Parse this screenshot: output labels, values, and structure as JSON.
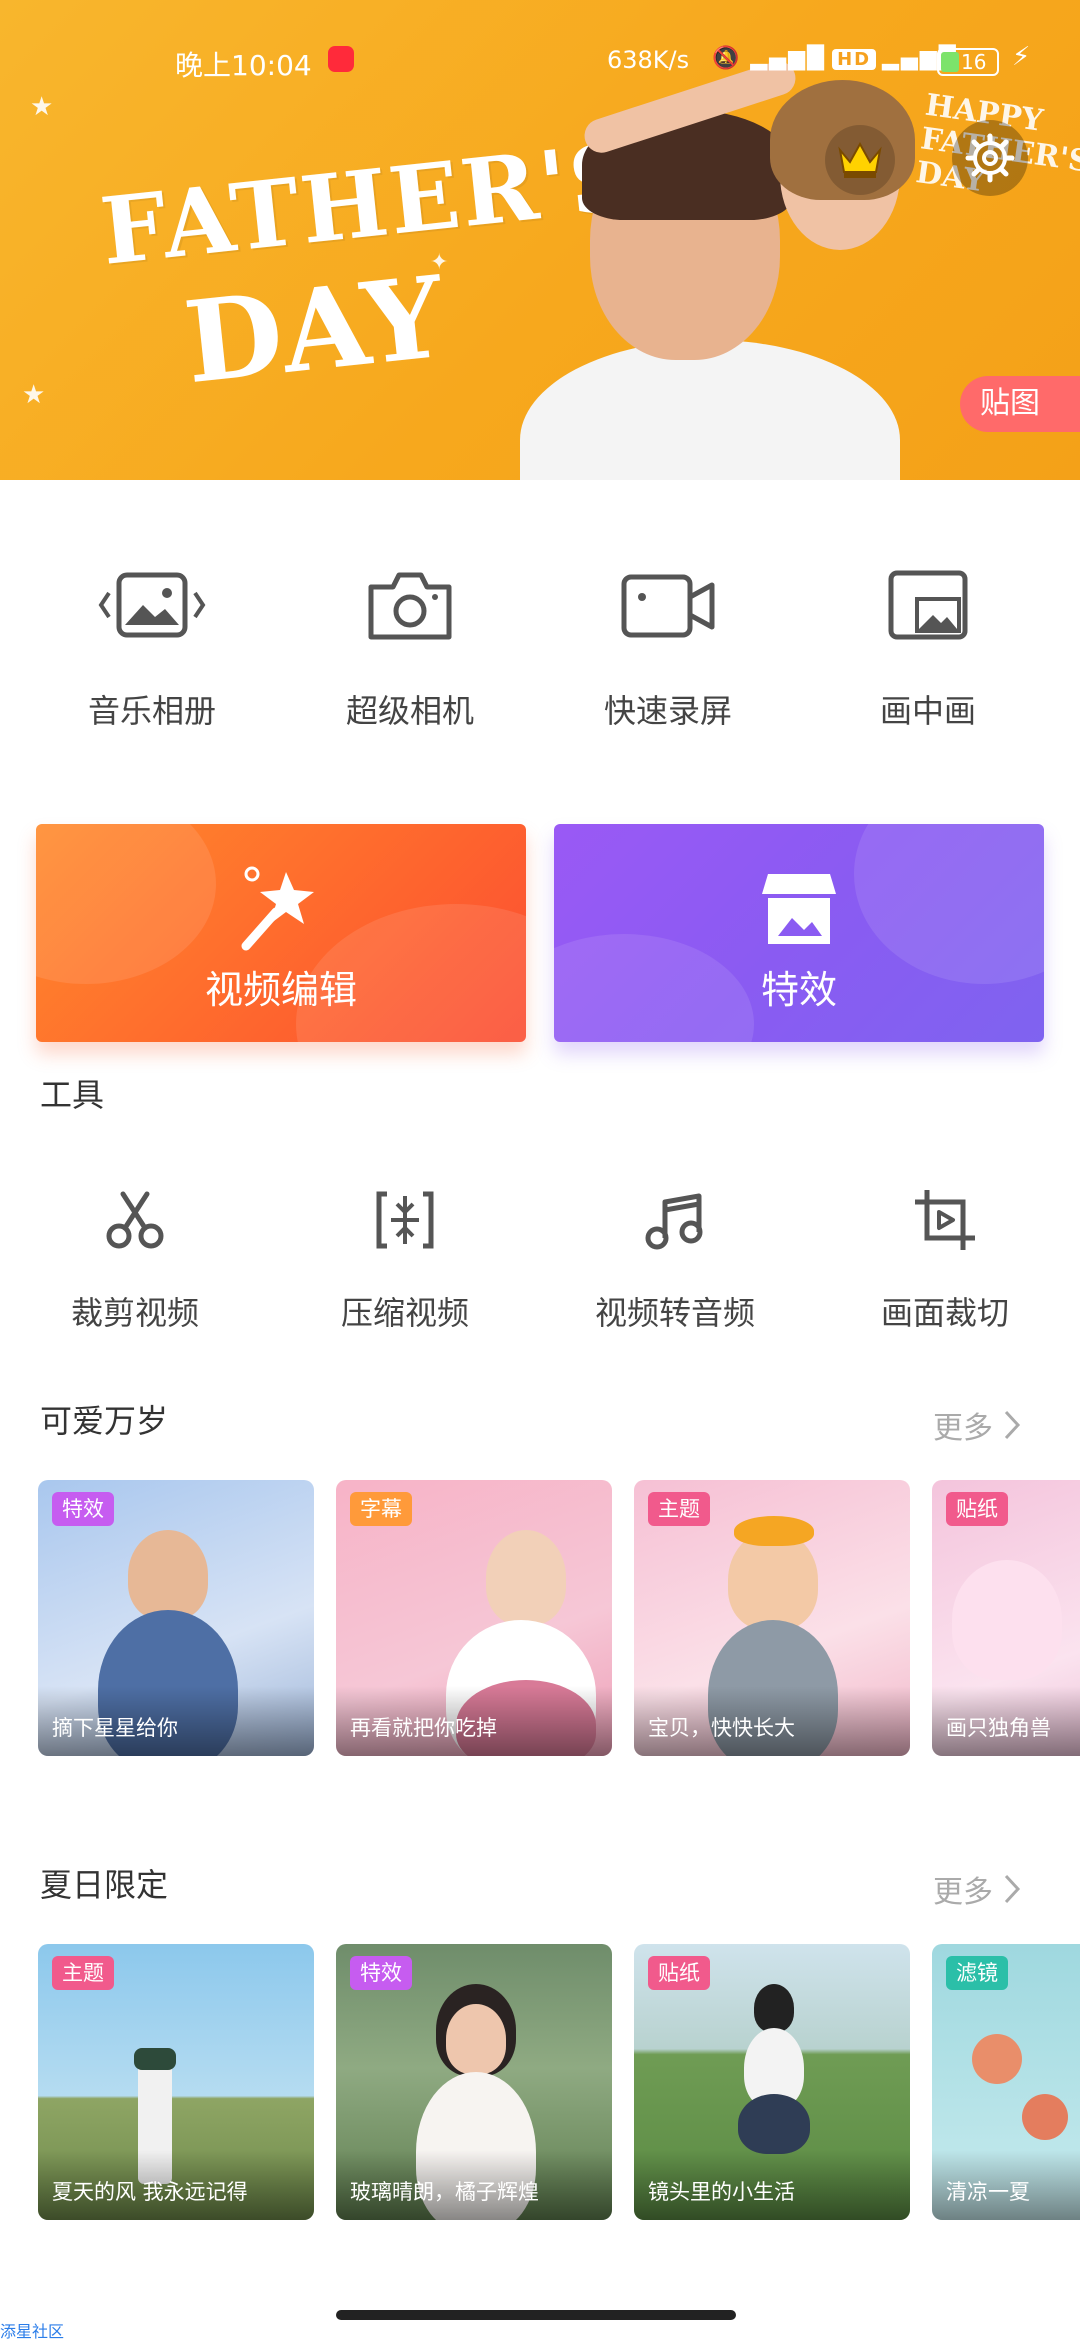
{
  "status_bar": {
    "time": "晚上10:04",
    "net_speed": "638K/s",
    "hd": "HD",
    "battery": "16"
  },
  "banner": {
    "title_line1": "FATHER'S",
    "title_line2": "DAY",
    "side_text": "HAPPY FATHER'S DAY",
    "sticker_label": "贴图"
  },
  "quick_actions": [
    {
      "label": "音乐相册",
      "icon": "photo-album-icon"
    },
    {
      "label": "超级相机",
      "icon": "camera-icon"
    },
    {
      "label": "快速录屏",
      "icon": "screen-record-icon"
    },
    {
      "label": "画中画",
      "icon": "picture-in-picture-icon"
    }
  ],
  "feature_cards": {
    "edit": {
      "label": "视频编辑",
      "icon": "magic-wand-icon"
    },
    "fx": {
      "label": "特效",
      "icon": "store-icon"
    }
  },
  "tools": {
    "title": "工具",
    "items": [
      {
        "label": "裁剪视频",
        "icon": "scissors-icon"
      },
      {
        "label": "压缩视频",
        "icon": "compress-icon"
      },
      {
        "label": "视频转音频",
        "icon": "music-note-icon"
      },
      {
        "label": "画面裁切",
        "icon": "crop-icon"
      }
    ]
  },
  "sections": [
    {
      "title": "可爱万岁",
      "more": "更多",
      "items": [
        {
          "tag": "特效",
          "caption": "摘下星星给你"
        },
        {
          "tag": "字幕",
          "caption": "再看就把你吃掉"
        },
        {
          "tag": "主题",
          "caption": "宝贝，快快长大"
        },
        {
          "tag": "贴纸",
          "caption": "画只独角兽"
        }
      ]
    },
    {
      "title": "夏日限定",
      "more": "更多",
      "items": [
        {
          "tag": "主题",
          "caption": "夏天的风 我永远记得"
        },
        {
          "tag": "特效",
          "caption": "玻璃晴朗，橘子辉煌"
        },
        {
          "tag": "贴纸",
          "caption": "镜头里的小生活"
        },
        {
          "tag": "滤镜",
          "caption": "清凉一夏"
        }
      ]
    }
  ],
  "footer": {
    "watermark": "添星社区"
  },
  "colors": {
    "banner": "#f8b62d",
    "edit_card": "#ff6b2d",
    "fx_card": "#8a5bf2",
    "tag_pink": "#f15a8c",
    "tag_orange": "#ff9a3a"
  }
}
